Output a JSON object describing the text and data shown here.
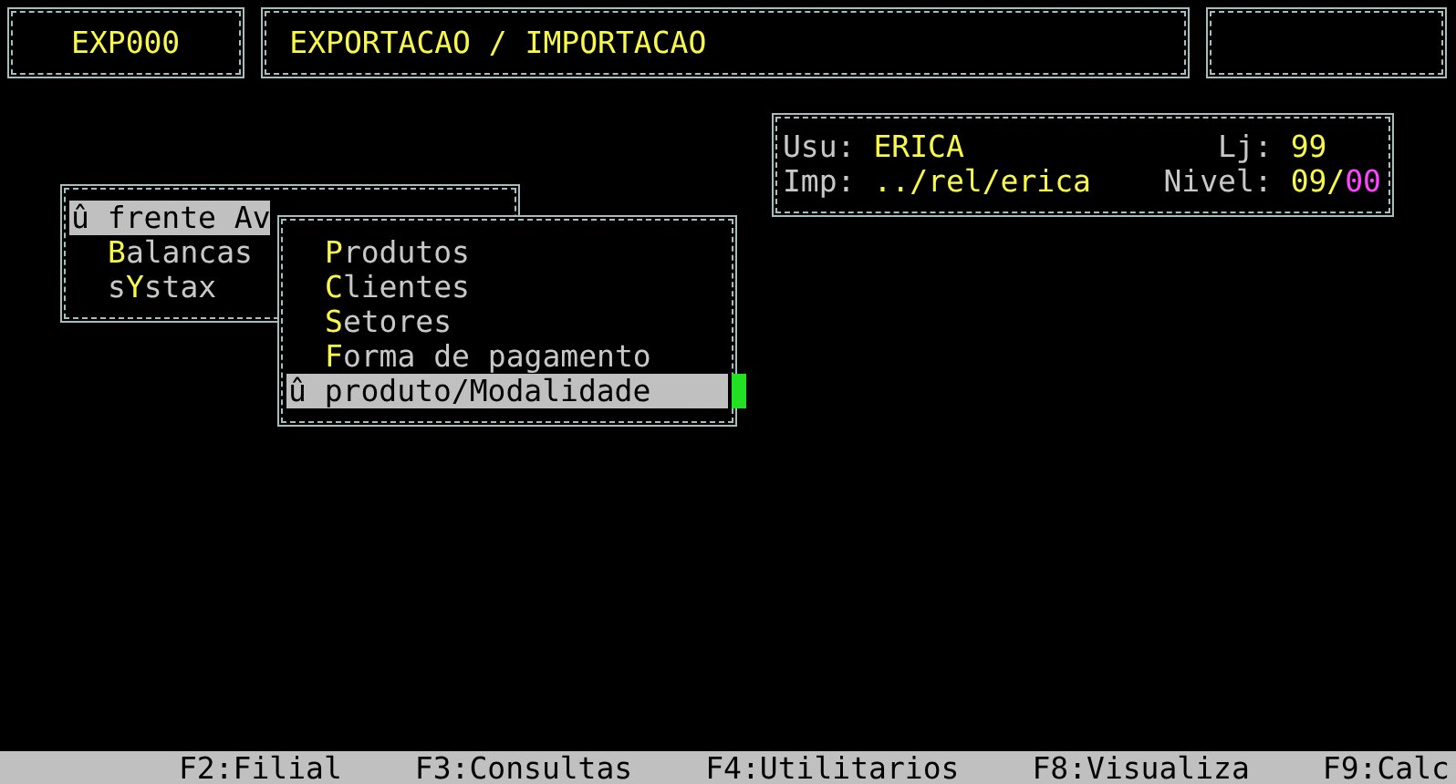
{
  "header": {
    "code": "EXP000",
    "title": "EXPORTACAO / IMPORTACAO"
  },
  "info": {
    "user_label": "Usu:",
    "user": "ERICA",
    "store_label": "Lj:",
    "store": "99",
    "printer_label": "Imp:",
    "printer": "../rel/erica",
    "level_label": "Nivel:",
    "level_value": "09/",
    "level_sub": "00"
  },
  "main_menu": {
    "items": [
      {
        "label": "û frente Av",
        "selected": true
      },
      {
        "label": "**B**alancas",
        "selected": false
      },
      {
        "label": "s**Y**stax",
        "selected": false
      }
    ]
  },
  "submenu": {
    "items": [
      {
        "label": "**P**rodutos",
        "selected": false
      },
      {
        "label": "**C**lientes",
        "selected": false
      },
      {
        "label": "**S**etores",
        "selected": false
      },
      {
        "label": "**F**orma de pagamento",
        "selected": false
      },
      {
        "label": "û produto/Modalidade",
        "selected": true
      }
    ]
  },
  "function_keys": [
    "F2:Filial",
    "F3:Consultas",
    "F4:Utilitarios",
    "F8:Visualiza",
    "F9:Calc"
  ]
}
